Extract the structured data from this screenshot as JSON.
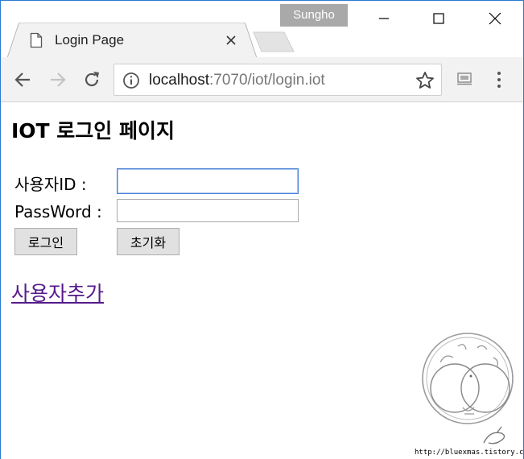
{
  "window": {
    "profile_name": "Sungho",
    "tab_title": "Login Page"
  },
  "toolbar": {
    "url_host": "localhost",
    "url_path": ":7070/iot/login.iot"
  },
  "page": {
    "heading": "IOT 로그인 페이지",
    "id_label": "사용자ID :",
    "id_value": "",
    "password_label": "PassWord :",
    "password_value": "",
    "login_button": "로그인",
    "reset_button": "초기화",
    "add_user_link": "사용자추가"
  },
  "watermark": {
    "url": "http://bluexmas.tistory.com/"
  },
  "colors": {
    "window_border": "#2b79d1",
    "profile_badge": "#a9a9a9",
    "toolbar_bg": "#f2f2f2",
    "visited_link": "#551a8b",
    "focus_ring": "#4a7fd8"
  }
}
